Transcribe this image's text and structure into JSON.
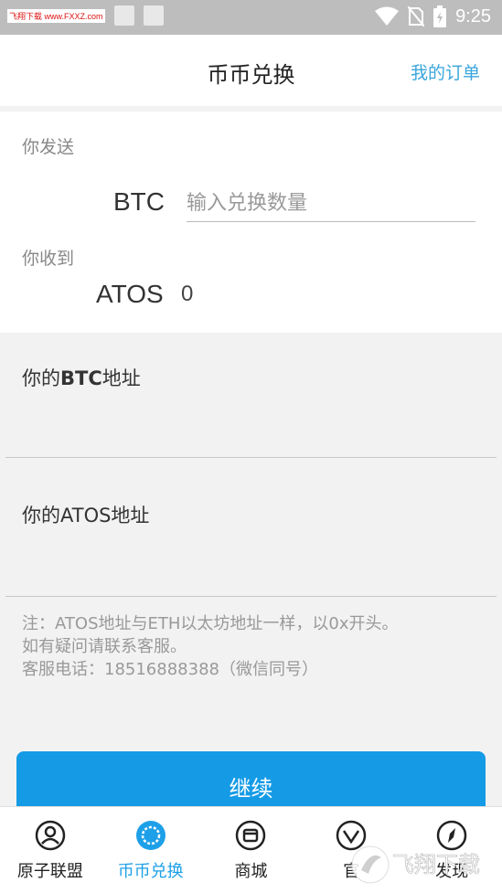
{
  "status_bar": {
    "brand": "飞翔下载 www.FXXZ.com",
    "time": "9:25"
  },
  "header": {
    "title": "币币兑换",
    "orders_link": "我的订单"
  },
  "exchange": {
    "send_label": "你发送",
    "send_coin": "BTC",
    "amount_placeholder": "输入兑换数量",
    "receive_label": "你收到",
    "receive_coin": "ATOS",
    "receive_amount": "0"
  },
  "btc_address": {
    "prefix": "你的",
    "coin": "BTC",
    "suffix": "地址"
  },
  "atos_address": {
    "label": "你的ATOS地址"
  },
  "note_lines": [
    "注：ATOS地址与ETH以太坊地址一样，以0x开头。",
    "如有疑问请联系客服。",
    "客服电话：18516888388（微信同号）"
  ],
  "continue_button": "继续",
  "nav": [
    {
      "label": "原子联盟",
      "icon": "person-icon",
      "active": false
    },
    {
      "label": "币币兑换",
      "icon": "exchange-icon",
      "active": true
    },
    {
      "label": "商城",
      "icon": "store-icon",
      "active": false
    },
    {
      "label": "官",
      "icon": "official-icon",
      "active": false
    },
    {
      "label": "发现",
      "icon": "compass-icon",
      "active": false
    }
  ],
  "watermark": "飞翔下载",
  "colors": {
    "accent": "#159be6",
    "link": "#3aa6dc",
    "statusbar": "#bdbdbd"
  }
}
